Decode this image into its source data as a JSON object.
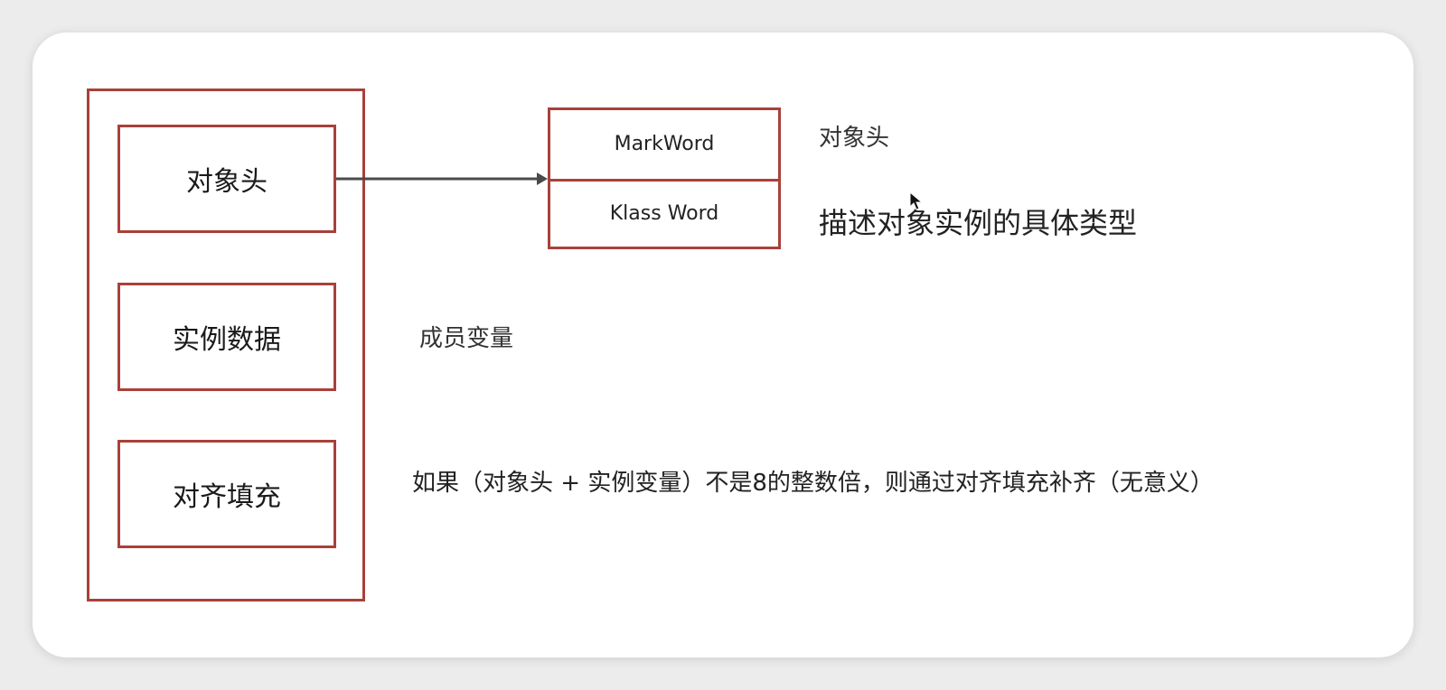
{
  "layout": {
    "object_header": "对象头",
    "instance_data": "实例数据",
    "padding": "对齐填充"
  },
  "header_detail": {
    "mark_word": "MarkWord",
    "klass_word": "Klass Word"
  },
  "notes": {
    "header": "对象头",
    "klass_word": "描述对象实例的具体类型",
    "instance_data": "成员变量",
    "padding": "如果（对象头 + 实例变量）不是8的整数倍，则通过对齐填充补齐（无意义）"
  },
  "colors": {
    "box_border": "#a8413a",
    "arrow": "#4a4a4a"
  }
}
